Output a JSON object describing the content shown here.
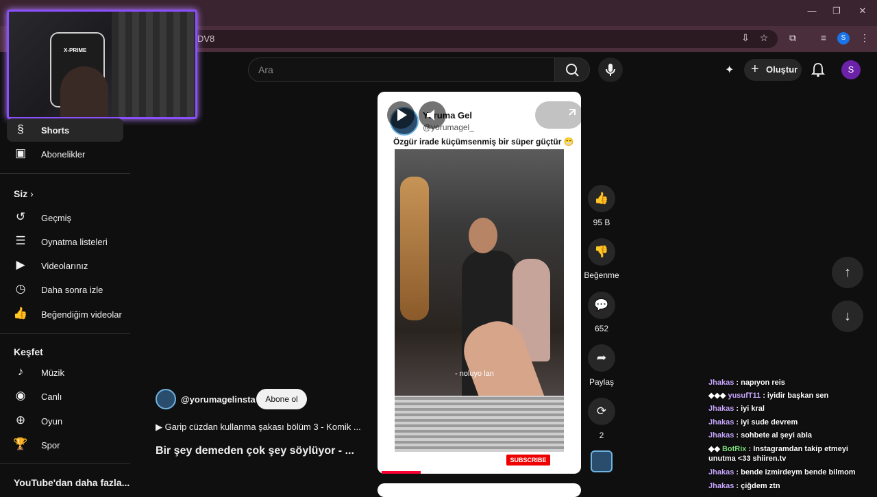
{
  "browser": {
    "url_fragment": "DV8",
    "profile_initial": "S"
  },
  "webcam": {
    "chair_logo": "X-PRIME"
  },
  "header": {
    "search_placeholder": "Ara",
    "create_label": "Oluştur",
    "avatar_initial": "S"
  },
  "sidebar": {
    "items_top": [
      {
        "label": "Shorts",
        "icon": "shorts-icon"
      },
      {
        "label": "Abonelikler",
        "icon": "subscriptions-icon"
      }
    ],
    "you_heading": "Siz",
    "you_items": [
      {
        "label": "Geçmiş",
        "icon": "history-icon"
      },
      {
        "label": "Oynatma listeleri",
        "icon": "playlists-icon"
      },
      {
        "label": "Videolarınız",
        "icon": "your-videos-icon"
      },
      {
        "label": "Daha sonra izle",
        "icon": "watch-later-icon"
      },
      {
        "label": "Beğendiğim videolar",
        "icon": "liked-icon"
      }
    ],
    "explore_heading": "Keşfet",
    "explore_items": [
      {
        "label": "Müzik",
        "icon": "music-icon"
      },
      {
        "label": "Canlı",
        "icon": "live-icon"
      },
      {
        "label": "Oyun",
        "icon": "gaming-icon"
      },
      {
        "label": "Spor",
        "icon": "sports-icon"
      }
    ],
    "more_heading": "YouTube'dan daha fazla..."
  },
  "short": {
    "channel_name": "Yoruma Gel",
    "channel_handle": "@yorumagel_",
    "caption": "Özgür irade küçümsenmiş bir süper güçtür 😁",
    "subtitle": "- noluyo lan",
    "subscribe_badge": "SUBSCRIBE",
    "progress": 0.2
  },
  "meta": {
    "channel": "@yorumagelinsta",
    "subscribe": "Abone ol",
    "playlist": "▶ Garip cüzdan kullanma şakası bölüm 3 - Komik ...",
    "title": "Bir şey demeden çok şey söylüyor - ..."
  },
  "actions": {
    "likes": "95 B",
    "dislike": "Beğenme",
    "comments": "652",
    "share": "Paylaş",
    "remix": "2"
  },
  "chat": [
    {
      "user": "Jhakas",
      "msg": ": napıyon reis"
    },
    {
      "user": "yusufT11",
      "msg": ": iyidir başkan sen"
    },
    {
      "user": "Jhakas",
      "msg": ": iyi kral"
    },
    {
      "user": "Jhakas",
      "msg": ": iyi sude devrem"
    },
    {
      "user": "Jhakas",
      "msg": ": sohbete al şeyi abla"
    },
    {
      "user": "BotRix",
      "msg": ": Instagramdan takip etmeyi unutma <33 shiiren.tv"
    },
    {
      "user": "Jhakas",
      "msg": ": bende izmirdeym bende bilmom"
    },
    {
      "user": "Jhakas",
      "msg": ": çiğdem ztn"
    }
  ]
}
